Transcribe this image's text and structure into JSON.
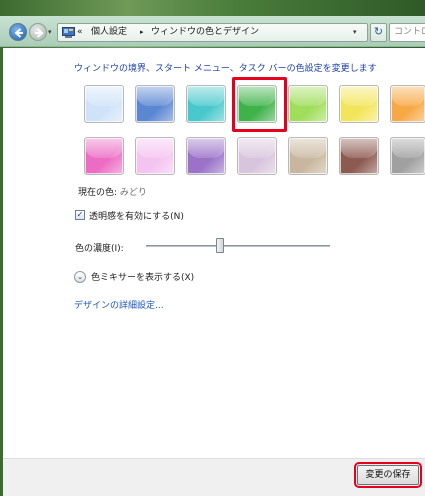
{
  "navigation": {
    "back_icon": "back-arrow-icon",
    "forward_icon": "forward-arrow-icon",
    "history_dropdown": "▾"
  },
  "address_bar": {
    "icon": "control-panel-icon",
    "separator": "«",
    "crumb_1": "個人設定",
    "crumb_arrow": "▸",
    "crumb_2": "ウィンドウの色とデザイン",
    "dropdown": "▾"
  },
  "refresh_button": {
    "label": "↻"
  },
  "search": {
    "placeholder": "コントロ"
  },
  "content": {
    "instruction": "ウィンドウの境界、スタート メニュー、タスク バーの色設定を変更します",
    "swatches_row1": [
      {
        "name": "sky",
        "color": "#cfe3f8"
      },
      {
        "name": "twilight",
        "color": "#5a86d2"
      },
      {
        "name": "sea",
        "color": "#48c8cc"
      },
      {
        "name": "leaf",
        "color": "#3fb24a"
      },
      {
        "name": "lime",
        "color": "#9fdd5a"
      },
      {
        "name": "lemon",
        "color": "#f3e55b"
      },
      {
        "name": "orange",
        "color": "#f7a844"
      }
    ],
    "swatches_row2": [
      {
        "name": "blush",
        "color": "#ec6cc4"
      },
      {
        "name": "pink",
        "color": "#f4c3f0"
      },
      {
        "name": "violet",
        "color": "#9a72c8"
      },
      {
        "name": "lavender",
        "color": "#d8c4dc"
      },
      {
        "name": "taupe",
        "color": "#c8b79e"
      },
      {
        "name": "chocolate",
        "color": "#8c5a50"
      },
      {
        "name": "slate",
        "color": "#a0a0a0"
      }
    ],
    "selected_index_row1": 3,
    "current_color_label": "現在の色: ",
    "current_color_value": "みどり",
    "transparency_checked": true,
    "transparency_check_mark": "✓",
    "transparency_label": "透明感を有効にする(N)",
    "intensity_label": "色の濃度(I):",
    "intensity_fraction": 0.4,
    "mixer_toggle_icon": "⌄",
    "mixer_label": "色ミキサーを表示する(X)",
    "advanced_link": "デザインの詳細設定..."
  },
  "footer": {
    "save_label": "変更の保存"
  },
  "colors": {
    "highlight": "#e6001e",
    "link": "#1a55c0"
  }
}
